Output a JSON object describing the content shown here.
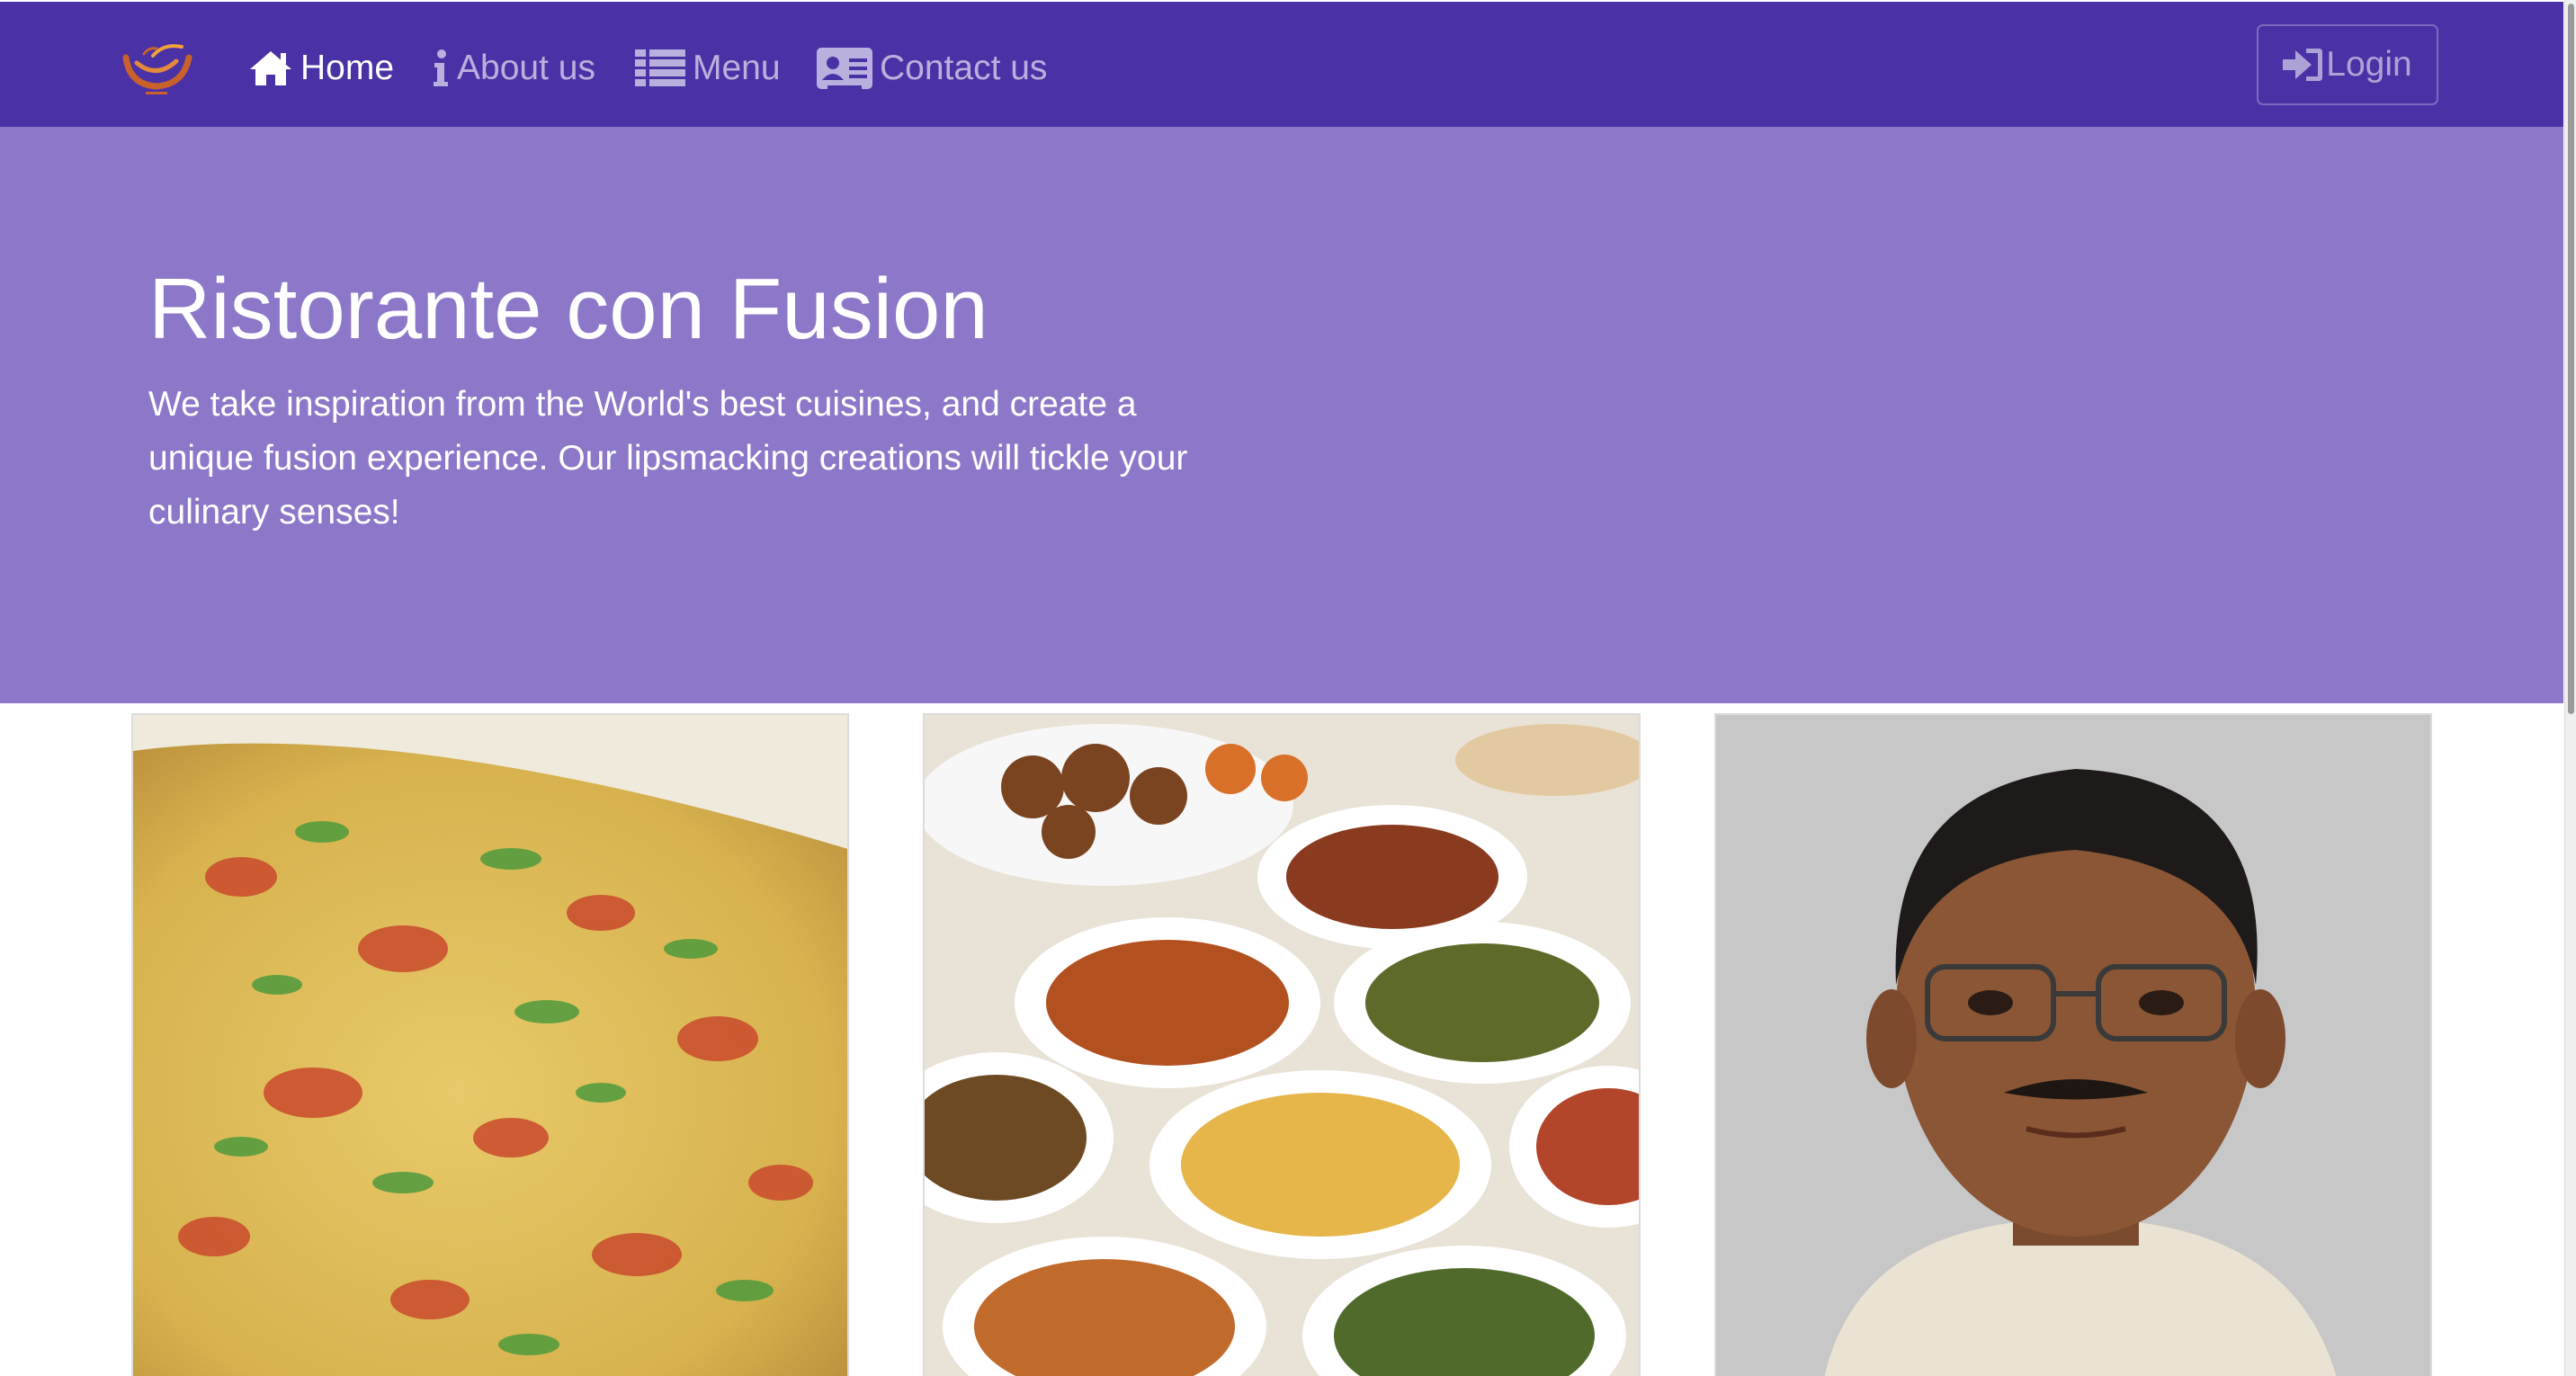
{
  "nav": {
    "items": [
      {
        "label": "Home",
        "icon": "home-icon",
        "active": true
      },
      {
        "label": "About us",
        "icon": "info-icon",
        "active": false
      },
      {
        "label": "Menu",
        "icon": "list-icon",
        "active": false
      },
      {
        "label": "Contact us",
        "icon": "address-card-icon",
        "active": false
      }
    ],
    "login_label": "Login",
    "login_icon": "sign-in-icon"
  },
  "jumbotron": {
    "title": "Ristorante con Fusion",
    "text": "We take inspiration from the World's best cuisines, and create a unique fusion experience. Our lipsmacking creations will tickle your culinary senses!"
  },
  "colors": {
    "navbar": "#4a31a5",
    "jumbotron": "#8d77c9",
    "logo_accent": "#c8612b"
  }
}
